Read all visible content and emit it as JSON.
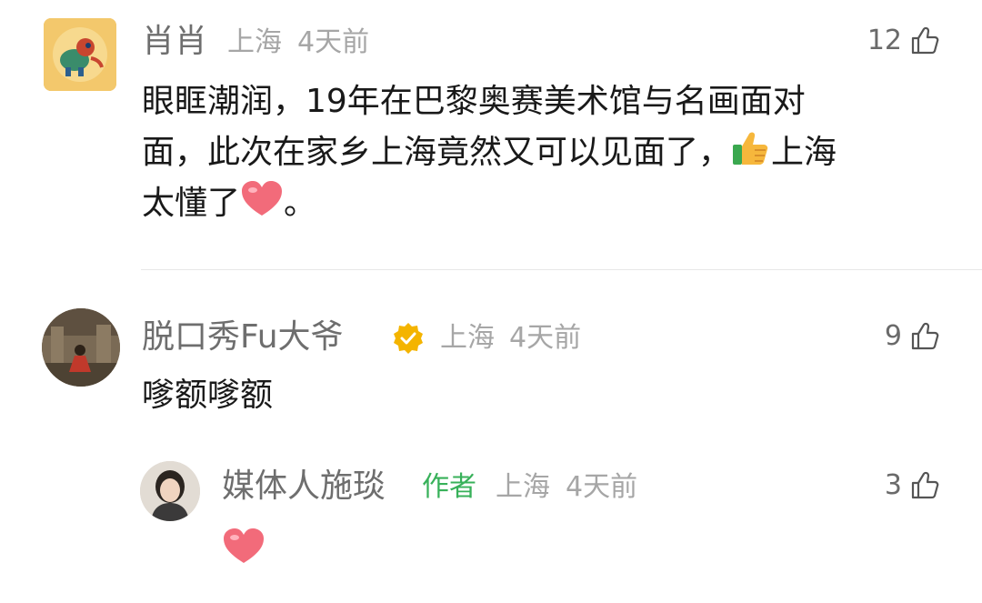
{
  "comments": [
    {
      "name": "肖肖",
      "location": "上海",
      "time": "4天前",
      "likes": "12",
      "text_line1": "眼眶潮润，19年在巴黎奥赛美术馆与名画面对",
      "text_line2a": "面，此次在家乡上海竟然又可以见面了，",
      "text_line2b": "上海",
      "text_line3a": "太懂了",
      "text_line3b": "。"
    },
    {
      "name": "脱口秀Fu大爷",
      "location": "上海",
      "time": "4天前",
      "likes": "9",
      "text": "嗲额嗲额"
    }
  ],
  "reply": {
    "name": "媒体人施琰",
    "author_tag": "作者",
    "location": "上海",
    "time": "4天前",
    "likes": "3"
  },
  "colors": {
    "author_tag": "#38b15a",
    "verified_badge": "#f4b400",
    "heart": "#f26b7a"
  },
  "icons": [
    "thumbs-up-icon",
    "verified-badge-icon",
    "heart-emoji-icon",
    "thumbs-up-emoji-icon"
  ]
}
